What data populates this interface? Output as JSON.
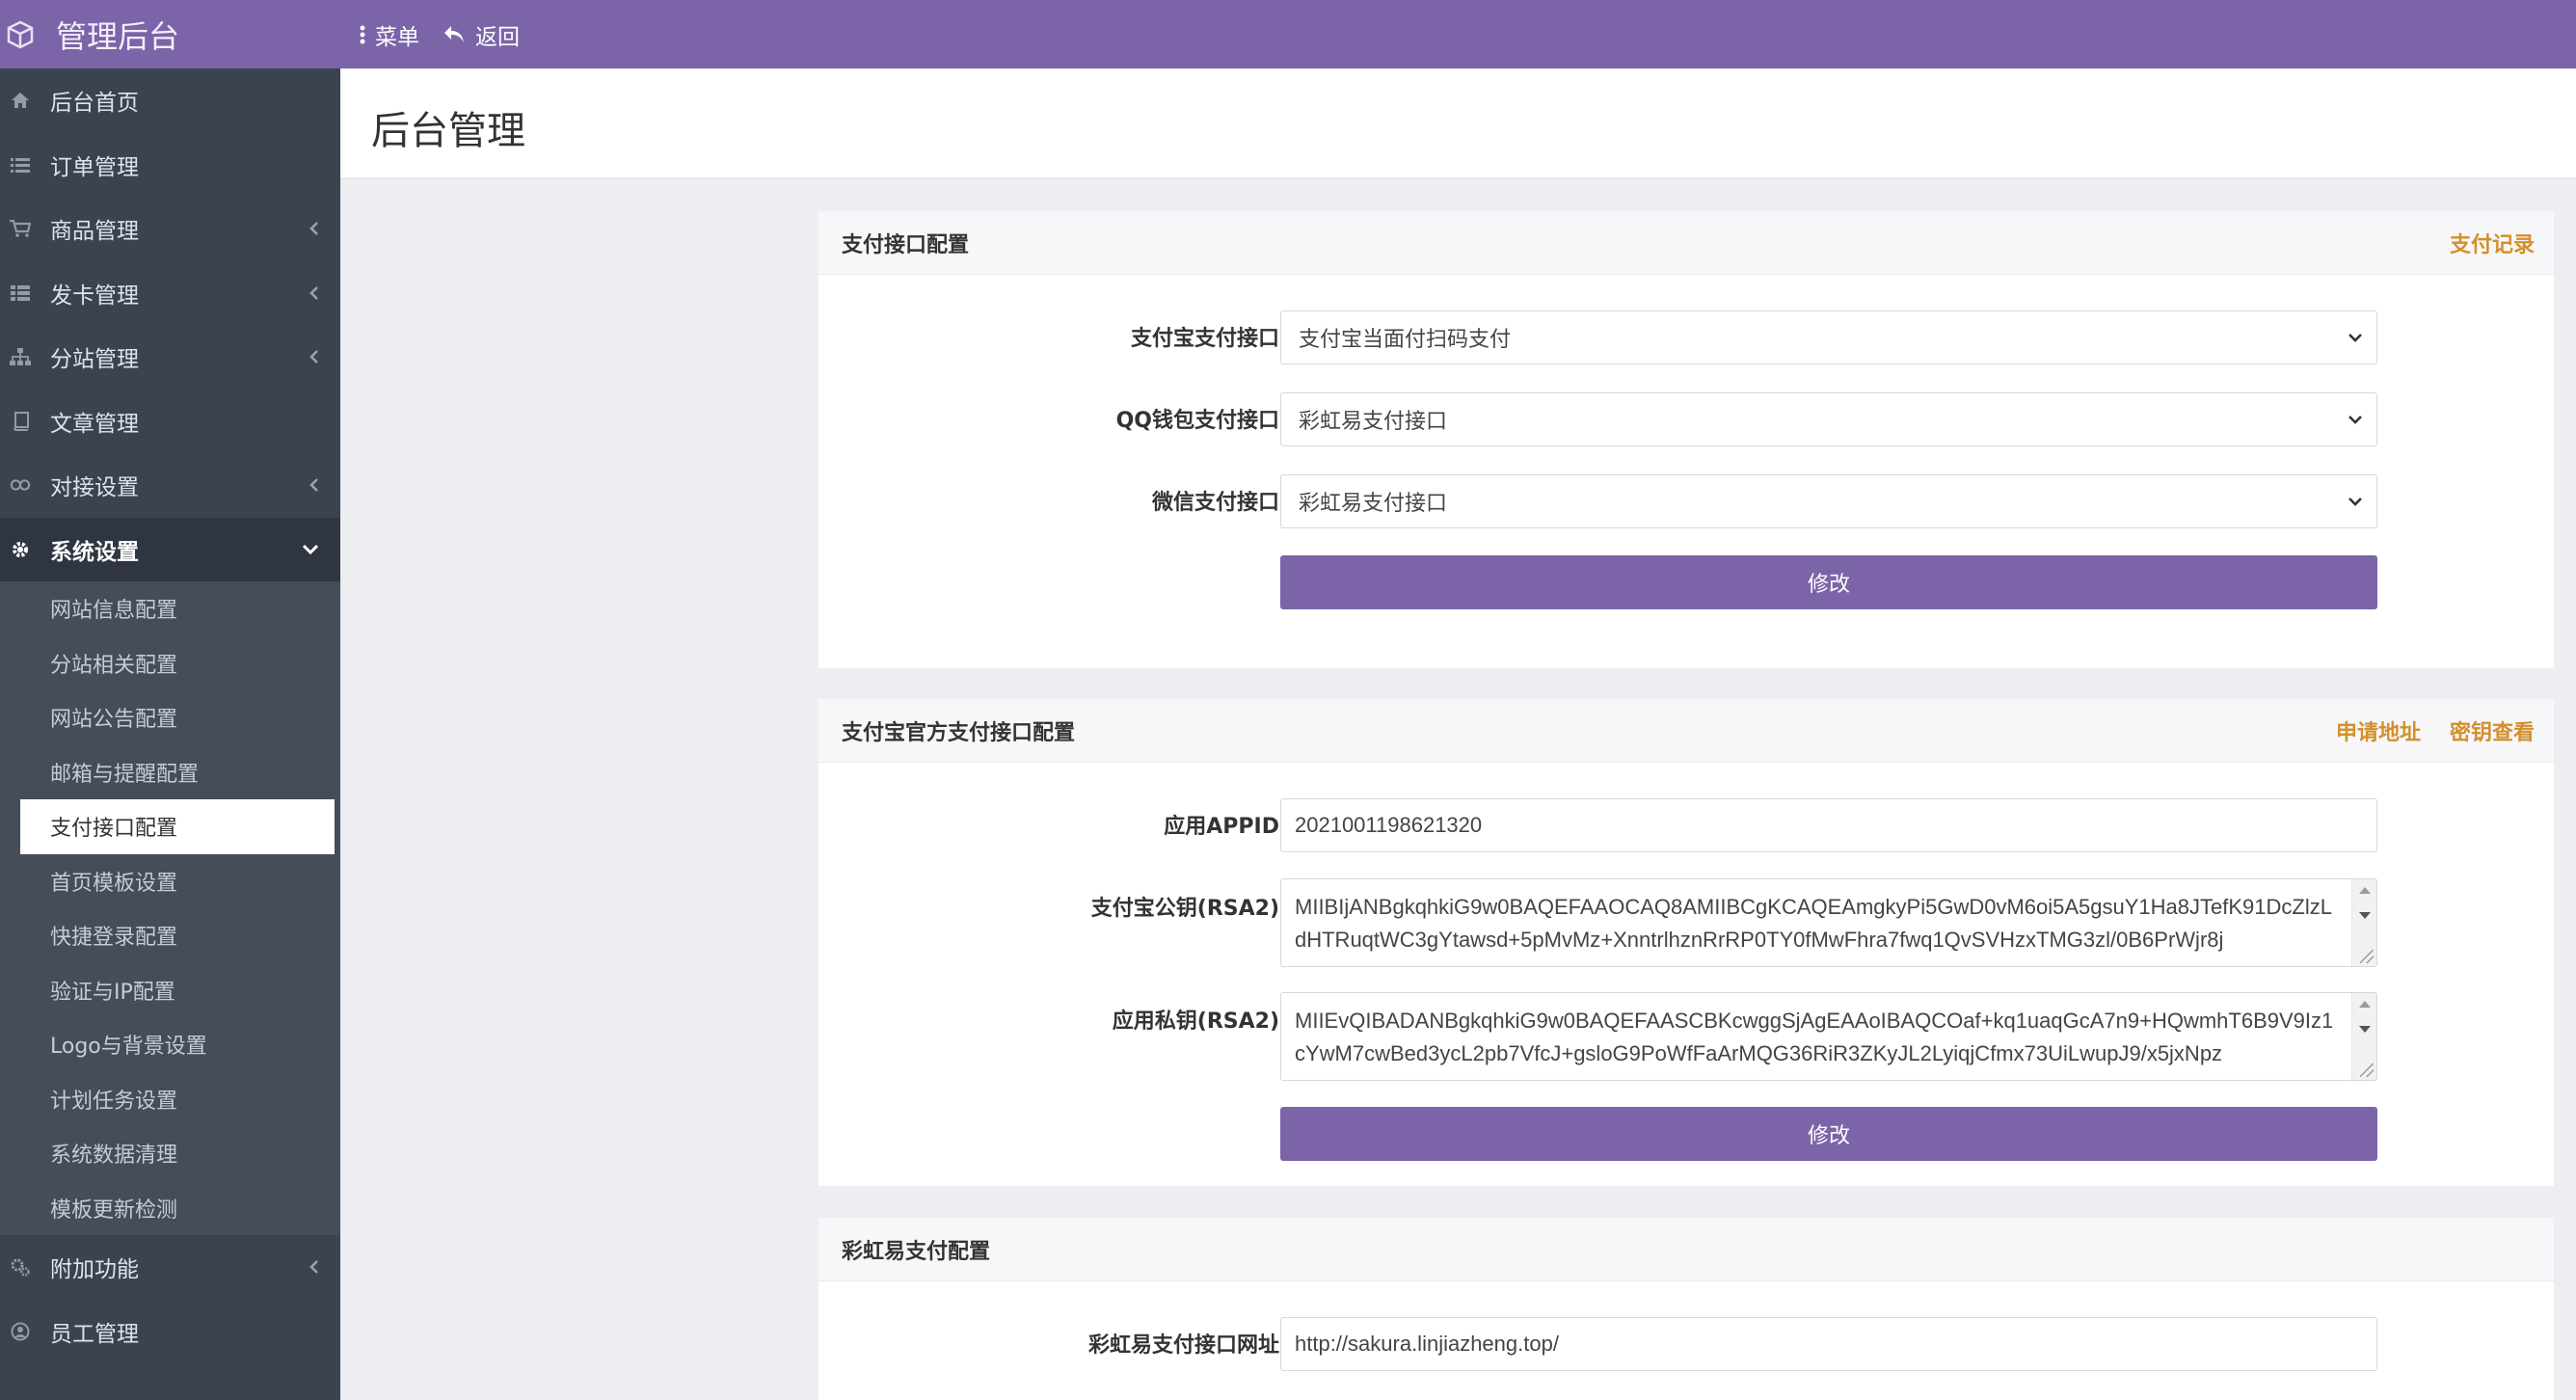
{
  "header": {
    "brand": "管理后台",
    "menu_label": "菜单",
    "back_label": "返回"
  },
  "sidebar": {
    "items": [
      {
        "label": "后台首页",
        "icon": "home-icon"
      },
      {
        "label": "订单管理",
        "icon": "list-icon"
      },
      {
        "label": "商品管理",
        "icon": "cart-icon",
        "has_children": true
      },
      {
        "label": "发卡管理",
        "icon": "grid-icon",
        "has_children": true
      },
      {
        "label": "分站管理",
        "icon": "sitemap-icon",
        "has_children": true
      },
      {
        "label": "文章管理",
        "icon": "book-icon"
      },
      {
        "label": "对接设置",
        "icon": "link-icon",
        "has_children": true
      },
      {
        "label": "系统设置",
        "icon": "gear-icon",
        "expanded": true
      }
    ],
    "submenu": [
      "网站信息配置",
      "分站相关配置",
      "网站公告配置",
      "邮箱与提醒配置",
      "支付接口配置",
      "首页模板设置",
      "快捷登录配置",
      "验证与IP配置",
      "Logo与背景设置",
      "计划任务设置",
      "系统数据清理",
      "模板更新检测"
    ],
    "bottom_items": [
      {
        "label": "附加功能",
        "icon": "cogs-icon",
        "has_children": true
      },
      {
        "label": "员工管理",
        "icon": "user-icon"
      }
    ]
  },
  "page": {
    "title": "后台管理"
  },
  "payment_panel": {
    "title": "支付接口配置",
    "link": "支付记录",
    "alipay_label": "支付宝支付接口",
    "alipay_value": "支付宝当面付扫码支付",
    "qq_label": "QQ钱包支付接口",
    "qq_value": "彩虹易支付接口",
    "wechat_label": "微信支付接口",
    "wechat_value": "彩虹易支付接口",
    "submit": "修改"
  },
  "alipay_panel": {
    "title": "支付宝官方支付接口配置",
    "link_apply": "申请地址",
    "link_key": "密钥查看",
    "appid_label": "应用APPID",
    "appid_value": "2021001198621320",
    "pubkey_label": "支付宝公钥(RSA2)",
    "pubkey_value": "MIIBIjANBgkqhkiG9w0BAQEFAAOCAQ8AMIIBCgKCAQEAmgkyPi5GwD0vM6oi5A5gsuY1Ha8JTefK91DcZlzLdHTRuqtWC3gYtawsd+5pMvMz+XnntrlhznRrRP0TY0fMwFhra7fwq1QvSVHzxTMG3zl/0B6PrWjr8j",
    "privkey_label": "应用私钥(RSA2)",
    "privkey_value": "MIIEvQIBADANBgkqhkiG9w0BAQEFAASCBKcwggSjAgEAAoIBAQCOaf+kq1uaqGcA7n9+HQwmhT6B9V9Iz1cYwM7cwBed3ycL2pb7VfcJ+gsloG9PoWfFaArMQG36RiR3ZKyJL2LyiqjCfmx73UiLwupJ9/x5jxNpz",
    "submit": "修改"
  },
  "rainbow_panel": {
    "title": "彩虹易支付配置",
    "url_label": "彩虹易支付接口网址",
    "url_value": "http://sakura.linjiazheng.top/"
  },
  "colors": {
    "accent": "#7b64a8",
    "sidebar": "#3b4350",
    "link": "#d38f2b"
  }
}
